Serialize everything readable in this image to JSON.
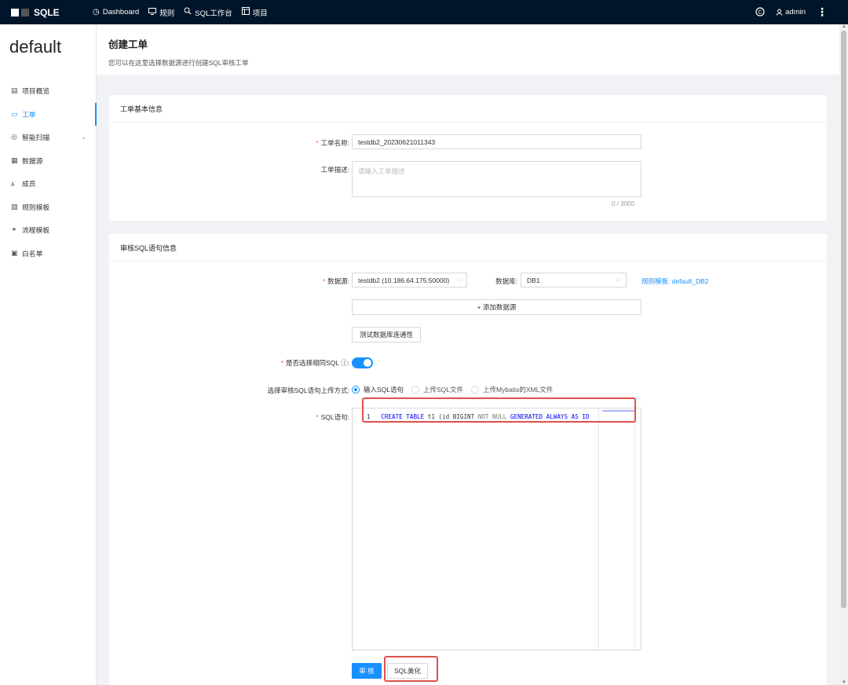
{
  "topbar": {
    "brand": "SQLE",
    "nav": [
      {
        "icon": "dashboard-icon",
        "glyph": "◷",
        "label": "Dashboard"
      },
      {
        "icon": "monitor-icon",
        "glyph": "🖵",
        "label": "规则"
      },
      {
        "icon": "search-icon",
        "glyph": "⚲",
        "label": "SQL工作台"
      },
      {
        "icon": "project-icon",
        "glyph": "▣",
        "label": "项目"
      }
    ],
    "user": "admin"
  },
  "sidebar": {
    "project": "default",
    "items": [
      {
        "icon": "overview-icon",
        "glyph": "▤",
        "label": "项目概览"
      },
      {
        "icon": "ticket-icon",
        "glyph": "▭",
        "label": "工单"
      },
      {
        "icon": "scan-icon",
        "glyph": "◎",
        "label": "智能扫描"
      },
      {
        "icon": "datasource-icon",
        "glyph": "▦",
        "label": "数据源"
      },
      {
        "icon": "member-icon",
        "glyph": "ᴀ",
        "label": "成员"
      },
      {
        "icon": "rule-template-icon",
        "glyph": "▧",
        "label": "规则模板"
      },
      {
        "icon": "flow-template-icon",
        "glyph": "⚭",
        "label": "流程模板"
      },
      {
        "icon": "whitelist-icon",
        "glyph": "▣",
        "label": "白名单"
      }
    ]
  },
  "header": {
    "title": "创建工单",
    "subtitle": "您可以在这里选择数据源进行创建SQL审核工单"
  },
  "basic": {
    "title": "工单基本信息",
    "name_label": "工单名称:",
    "name_value": "testdb2_20230621011343",
    "desc_label": "工单描述:",
    "desc_placeholder": "请输入工单描述",
    "desc_counter": "0 / 3000"
  },
  "sql": {
    "title": "审核SQL语句信息",
    "datasource_label": "数据源:",
    "datasource_value": "testdb2 (10.186.64.175:50000)",
    "database_label": "数据库:",
    "database_value": "DB1",
    "rule_template_link": "规则模板: default_DB2",
    "add_datasource": "+ 添加数据源",
    "test_connection": "测试数据库连通性",
    "same_sql_label": "是否选择相同SQL",
    "same_sql_on": true,
    "upload_label": "选择审核SQL语句上传方式:",
    "upload_options": [
      "输入SQL语句",
      "上传SQL文件",
      "上传Mybatis的XML文件"
    ],
    "upload_selected": "输入SQL语句",
    "statement_label": "SQL语句:",
    "editor": {
      "line_no": "1",
      "kw1": "CREATE TABLE",
      "t1": "t1 (id BIGINT",
      "kw2": "NOT NULL",
      "kw3": "GENERATED ALWAYS AS",
      "kw4": "ID"
    },
    "audit_button": "审 核",
    "beautify_button": "SQL美化"
  }
}
